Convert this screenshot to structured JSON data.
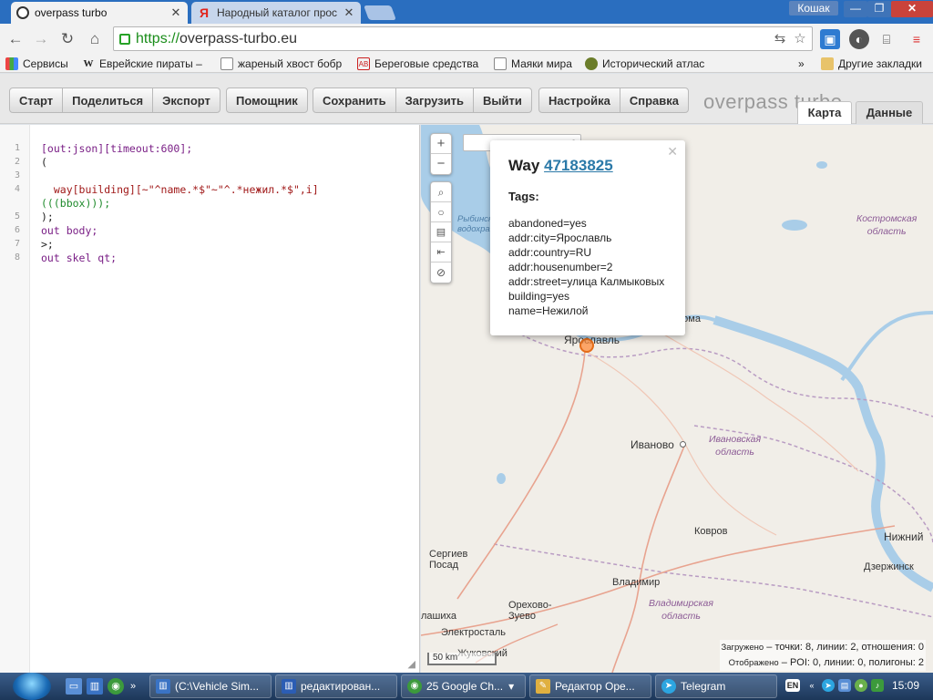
{
  "browser": {
    "tabs": [
      {
        "title": "overpass turbo",
        "favicon": "overpass-icon"
      },
      {
        "title": "Народный каталог прос",
        "favicon": "Я"
      }
    ],
    "user": "Кошак",
    "url_scheme": "https://",
    "url_host": "overpass-turbo.eu",
    "window_buttons": {
      "minimize": "—",
      "restore": "❐",
      "close": "✕"
    }
  },
  "bookmarks": {
    "items": [
      {
        "label": "Сервисы",
        "icon": "apps-icon"
      },
      {
        "label": "Еврейские пираты –",
        "icon": "W"
      },
      {
        "label": "жареный хвост бобр",
        "icon": "page-icon"
      },
      {
        "label": "Береговые средства",
        "icon": "AB"
      },
      {
        "label": "Маяки мира",
        "icon": "page-icon"
      },
      {
        "label": "Исторический атлас",
        "icon": "globe-icon"
      }
    ],
    "more": "»",
    "other_folder": "Другие закладки"
  },
  "overpass": {
    "group1": [
      "Старт",
      "Поделиться",
      "Экспорт"
    ],
    "group2": [
      "Помощник"
    ],
    "group3": [
      "Сохранить",
      "Загрузить",
      "Выйти"
    ],
    "group4": [
      "Настройка",
      "Справка"
    ],
    "logo": "overpass turbo",
    "view_tabs": {
      "map": "Карта",
      "data": "Данные"
    }
  },
  "editor": {
    "line_numbers": [
      "1",
      "2",
      "3",
      "4",
      "5",
      "6",
      "7",
      "8"
    ],
    "lines": {
      "l1": "[out:json][timeout:600];",
      "l2": "(",
      "l3": "",
      "l4a": "  way[building][~\"^name.*$\"~\"^.*нежил.*$\",i]",
      "l4b": "(((bbox)));",
      "l5": ");",
      "l6": "out body;",
      "l7": ">;",
      "l8": "out skel qt;"
    }
  },
  "map": {
    "popup": {
      "type": "Way",
      "id": "47183825",
      "tags_title": "Tags:",
      "tags": [
        "abandoned=yes",
        "addr:city=Ярославль",
        "addr:country=RU",
        "addr:housenumber=2",
        "addr:street=улица Калмыковых",
        "building=yes",
        "name=Нежилой"
      ]
    },
    "places": {
      "yaroslavl": "Ярославль",
      "kostroma": "Кострома",
      "ivanovo": "Иваново",
      "kovrov": "Ковров",
      "vladimir": "Владимир",
      "nizhny": "Нижний",
      "dzerzhinsk": "Дзержинск",
      "sergiev_posad_1": "Сергиев",
      "sergiev_posad_2": "Посад",
      "orekhovo_1": "Орехово-",
      "orekhovo_2": "Зуево",
      "elektrostal": "Электросталь",
      "lashikha": "лашиха",
      "zhukovsky": "Жуковский"
    },
    "regions": {
      "kostroma_1": "Костромская",
      "kostroma_2": "область",
      "ivanovo_1": "Ивановская",
      "ivanovo_2": "область",
      "vladimir_1": "Владимирская",
      "vladimir_2": "область"
    },
    "water": {
      "rybinsk_1": "Рыбинск",
      "rybinsk_2": "водохран"
    },
    "scale": "50 km",
    "stats": {
      "loaded_label": "Загружено",
      "loaded": "– точки: 8, линии: 2, отношения: 0",
      "shown_label": "Отображено",
      "shown": "– POI: 0, линии: 0, полигоны: 2"
    }
  },
  "taskbar": {
    "tasks": [
      {
        "label": "(C:\\Vehicle Sim...",
        "icon": "explorer-icon"
      },
      {
        "label": "редактирован...",
        "icon": "word-icon"
      },
      {
        "label": "25 Google Ch...",
        "icon": "chrome-icon"
      },
      {
        "label": "Редактор Оре...",
        "icon": "editor-icon"
      },
      {
        "label": "Telegram",
        "icon": "telegram-icon"
      }
    ],
    "lang": "EN",
    "clock": "15:09"
  },
  "colors": {
    "accent": "#2b79a8",
    "title_bar": "#2a6ebf",
    "marker": "#e46c19",
    "water": "#a9cde8"
  }
}
